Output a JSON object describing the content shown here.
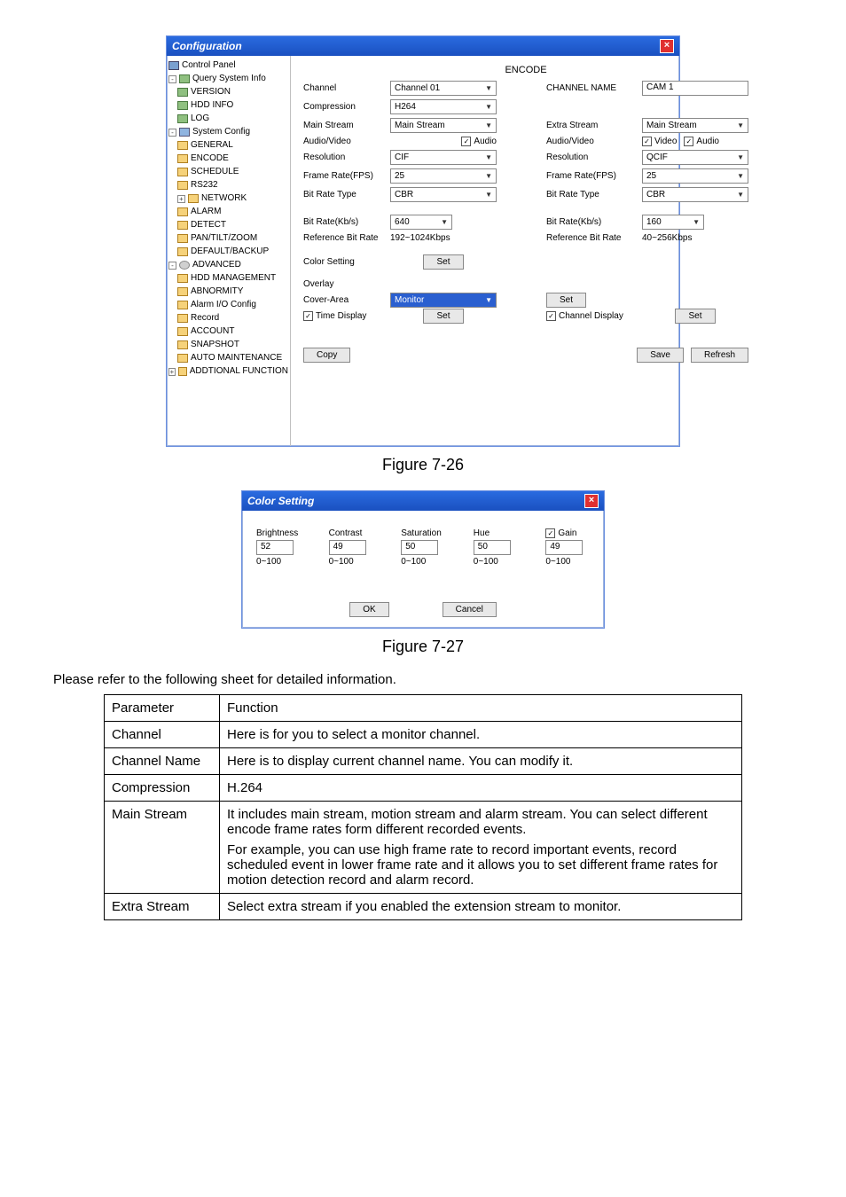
{
  "config": {
    "title": "Configuration",
    "tree": {
      "control_panel": "Control Panel",
      "query": "Query System Info",
      "version": "VERSION",
      "hdd_info": "HDD INFO",
      "log": "LOG",
      "system_config": "System Config",
      "general": "GENERAL",
      "encode": "ENCODE",
      "schedule": "SCHEDULE",
      "rs232": "RS232",
      "network": "NETWORK",
      "alarm": "ALARM",
      "detect": "DETECT",
      "ptz": "PAN/TILT/ZOOM",
      "default_backup": "DEFAULT/BACKUP",
      "advanced": "ADVANCED",
      "hdd_mgmt": "HDD MANAGEMENT",
      "abnormity": "ABNORMITY",
      "alarm_io": "Alarm I/O Config",
      "record": "Record",
      "account": "ACCOUNT",
      "snapshot": "SNAPSHOT",
      "auto_maint": "AUTO MAINTENANCE",
      "addtional": "ADDTIONAL FUNCTION"
    },
    "panel": {
      "title": "ENCODE",
      "labels": {
        "channel": "Channel",
        "channel_name": "CHANNEL NAME",
        "compression": "Compression",
        "main_stream": "Main Stream",
        "extra_stream": "Extra Stream",
        "audio_video": "Audio/Video",
        "resolution": "Resolution",
        "frame_rate": "Frame Rate(FPS)",
        "bit_rate_type": "Bit Rate Type",
        "bit_rate": "Bit Rate(Kb/s)",
        "ref_bit_rate": "Reference Bit Rate",
        "color_setting": "Color Setting",
        "overlay": "Overlay",
        "cover_area": "Cover-Area",
        "time_display": "Time Display",
        "channel_display": "Channel Display",
        "video": "Video",
        "audio": "Audio"
      },
      "values": {
        "channel": "Channel 01",
        "channel_name": "CAM 1",
        "compression": "H264",
        "main_stream": "Main Stream",
        "extra_stream": "Main Stream",
        "main_res": "CIF",
        "extra_res": "QCIF",
        "main_fps": "25",
        "extra_fps": "25",
        "main_brt": "CBR",
        "extra_brt": "CBR",
        "main_br": "640",
        "extra_br": "160",
        "main_ref": "192~1024Kbps",
        "extra_ref": "40~256Kbps",
        "cover_area": "Monitor"
      },
      "buttons": {
        "set": "Set",
        "copy": "Copy",
        "save": "Save",
        "refresh": "Refresh"
      }
    }
  },
  "color_setting": {
    "title": "Color Setting",
    "brightness": {
      "label": "Brightness",
      "value": "52",
      "range": "0~100"
    },
    "contrast": {
      "label": "Contrast",
      "value": "49",
      "range": "0~100"
    },
    "saturation": {
      "label": "Saturation",
      "value": "50",
      "range": "0~100"
    },
    "hue": {
      "label": "Hue",
      "value": "50",
      "range": "0~100"
    },
    "gain": {
      "label": "Gain",
      "value": "49",
      "range": "0~100"
    },
    "ok": "OK",
    "cancel": "Cancel"
  },
  "captions": {
    "fig1": "Figure 7-26",
    "fig2": "Figure 7-27"
  },
  "body_text": "Please refer to the following sheet for detailed information.",
  "table": {
    "header": {
      "param": "Parameter",
      "func": "Function"
    },
    "rows": [
      {
        "param": "Channel",
        "func": "Here is for you to select a monitor channel."
      },
      {
        "param": "Channel Name",
        "func": "Here is to display current channel name. You can modify it."
      },
      {
        "param": "Compression",
        "func": "H.264"
      },
      {
        "param": "Main Stream",
        "func": "It includes main stream, motion stream and alarm stream. You can select different encode frame rates form different recorded events.",
        "func2": "For example, you can use high frame rate to record important events, record scheduled event in lower frame rate and it allows you to set different frame rates for motion detection record and alarm record."
      },
      {
        "param": "Extra Stream",
        "func": "Select extra stream if you enabled the extension stream to monitor."
      }
    ]
  }
}
